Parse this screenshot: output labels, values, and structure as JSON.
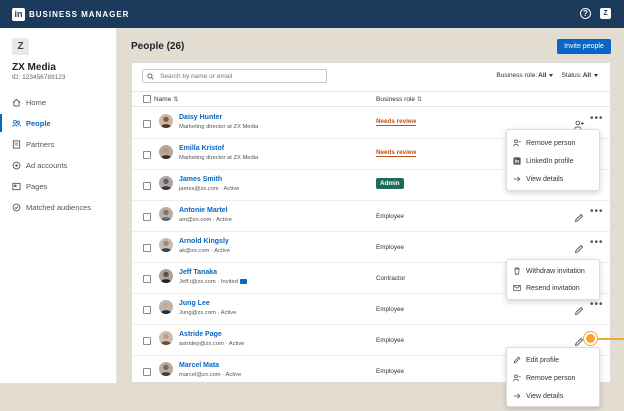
{
  "topbar": {
    "logo": "in",
    "title": "BUSINESS MANAGER",
    "help_icon": "question-circle-icon",
    "user_avatar": "Z"
  },
  "sidebar": {
    "org_initial": "Z",
    "org_name": "ZX Media",
    "org_id": "ID: 123456789123",
    "items": [
      {
        "label": "Home",
        "icon": "home-icon"
      },
      {
        "label": "People",
        "icon": "people-icon"
      },
      {
        "label": "Partners",
        "icon": "partners-icon"
      },
      {
        "label": "Ad accounts",
        "icon": "ad-accounts-icon"
      },
      {
        "label": "Pages",
        "icon": "pages-icon"
      },
      {
        "label": "Matched audiences",
        "icon": "matched-audiences-icon"
      }
    ]
  },
  "main": {
    "title": "People (26)",
    "invite_label": "Invite people",
    "search_placeholder": "Search by name or email",
    "filters": [
      {
        "label": "Business role:",
        "value": "All"
      },
      {
        "label": "Status:",
        "value": "All"
      }
    ],
    "columns": {
      "name": "Name",
      "role": "Business role"
    },
    "rows": [
      {
        "name": "Daisy Hunter",
        "sub": "Marketing director at ZX Media",
        "role": "Needs review",
        "role_style": "review",
        "action": "add-person-icon"
      },
      {
        "name": "Emilla Kristof",
        "sub": "Marketing director at ZX Media",
        "role": "Needs review",
        "role_style": "review",
        "action": ""
      },
      {
        "name": "James Smith",
        "sub": "james@zx.com · Active",
        "role": "Admin",
        "role_style": "admin",
        "action": ""
      },
      {
        "name": "Antonie Martel",
        "sub": "am@zx.com · Active",
        "role": "Employee",
        "role_style": "plain",
        "action": "pencil-icon"
      },
      {
        "name": "Arnold Kingsly",
        "sub": "ak@zx.com · Active",
        "role": "Employee",
        "role_style": "plain",
        "action": "pencil-icon"
      },
      {
        "name": "Jeff Tanaka",
        "sub": "Jeff.t@zx.com · Invited",
        "role": "Contractor",
        "role_style": "plain",
        "action": ""
      },
      {
        "name": "Jung Lee",
        "sub": "Jung@zx.com · Active",
        "role": "Employee",
        "role_style": "plain",
        "action": "pencil-icon"
      },
      {
        "name": "Astride Page",
        "sub": "astridep@zx.com · Active",
        "role": "Employee",
        "role_style": "plain",
        "action": "pencil-icon"
      },
      {
        "name": "Marcel Mata",
        "sub": "marcel@zx.com · Active",
        "role": "Employee",
        "role_style": "plain",
        "action": ""
      }
    ]
  },
  "menus": {
    "menu1": [
      {
        "label": "Remove person",
        "icon": "remove-person-icon"
      },
      {
        "label": "LinkedIn profile",
        "icon": "linkedin-icon"
      },
      {
        "label": "View details",
        "icon": "arrow-right-icon"
      }
    ],
    "menu2": [
      {
        "label": "Withdraw invitation",
        "icon": "trash-icon"
      },
      {
        "label": "Resend invitation",
        "icon": "mail-icon"
      }
    ],
    "menu3": [
      {
        "label": "Edit profile",
        "icon": "pencil-icon"
      },
      {
        "label": "Remove person",
        "icon": "remove-person-icon"
      },
      {
        "label": "View details",
        "icon": "arrow-right-icon"
      }
    ]
  },
  "colors": {
    "topbar": "#1b3a5c",
    "accent": "#0a66c2",
    "needs_review": "#c4511a",
    "admin_badge": "#1f6b5a",
    "callout": "#f4a533",
    "backdrop": "#e3ddd1"
  }
}
